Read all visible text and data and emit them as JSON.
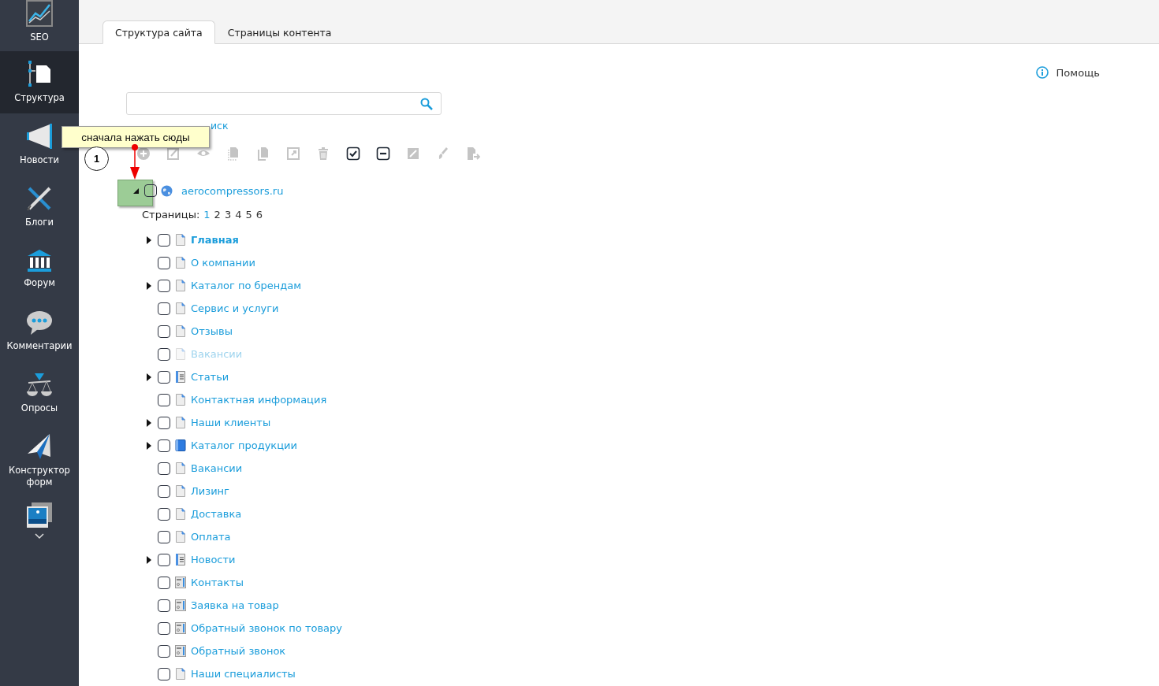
{
  "sidebar": {
    "items": [
      {
        "label": "SEO",
        "kind": "seo",
        "selected": false
      },
      {
        "label": "Структура",
        "kind": "structure",
        "selected": true
      },
      {
        "label": "Новости",
        "kind": "news",
        "selected": false
      },
      {
        "label": "Блоги",
        "kind": "blogs",
        "selected": false
      },
      {
        "label": "Форум",
        "kind": "forum",
        "selected": false
      },
      {
        "label": "Комментарии",
        "kind": "comments",
        "selected": false
      },
      {
        "label": "Опросы",
        "kind": "polls",
        "selected": false
      },
      {
        "label": "Конструктор форм",
        "kind": "forms",
        "selected": false
      },
      {
        "kind": "gallery",
        "selected": false
      }
    ]
  },
  "tabs": [
    {
      "label": "Структура сайта",
      "selected": true
    },
    {
      "label": "Страницы контента",
      "selected": false
    }
  ],
  "help": {
    "label": "Помощь"
  },
  "search_link": {
    "label": "иск"
  },
  "toolbar": [
    {
      "kind": "add",
      "disabled": true
    },
    {
      "kind": "edit",
      "disabled": true
    },
    {
      "kind": "view",
      "disabled": true
    },
    {
      "kind": "copy-dotted",
      "disabled": true
    },
    {
      "kind": "copy",
      "disabled": true
    },
    {
      "kind": "open",
      "disabled": true
    },
    {
      "kind": "delete",
      "disabled": true
    },
    {
      "kind": "check",
      "disabled": false
    },
    {
      "kind": "uncheck",
      "disabled": false
    },
    {
      "kind": "image",
      "disabled": true
    },
    {
      "kind": "brush",
      "disabled": true
    },
    {
      "kind": "export",
      "disabled": true
    }
  ],
  "annotation": {
    "callout": "сначала нажать сюды",
    "step": "1"
  },
  "tree": {
    "root": {
      "label": "aerocompressors.ru",
      "expanded": true,
      "checked": false
    },
    "pages_label": "Страницы:",
    "pages": [
      {
        "label": "1",
        "selected": true
      },
      {
        "label": "2",
        "selected": false
      },
      {
        "label": "3",
        "selected": false
      },
      {
        "label": "4",
        "selected": false
      },
      {
        "label": "5",
        "selected": false
      },
      {
        "label": "6",
        "selected": false
      }
    ],
    "children": [
      {
        "label": "Главная",
        "kind": "page",
        "expandable": true,
        "checked": false,
        "is_default": true,
        "inactive": false
      },
      {
        "label": "О компании",
        "kind": "page",
        "expandable": false,
        "checked": false,
        "is_default": false,
        "inactive": false
      },
      {
        "label": "Каталог по брендам",
        "kind": "page",
        "expandable": true,
        "checked": false,
        "is_default": false,
        "inactive": false
      },
      {
        "label": "Сервис и услуги",
        "kind": "page",
        "expandable": false,
        "checked": false,
        "is_default": false,
        "inactive": false
      },
      {
        "label": "Отзывы",
        "kind": "page",
        "expandable": false,
        "checked": false,
        "is_default": false,
        "inactive": false
      },
      {
        "label": "Вакансии",
        "kind": "page",
        "expandable": false,
        "checked": false,
        "is_default": false,
        "inactive": true
      },
      {
        "label": "Статьи",
        "kind": "list",
        "expandable": true,
        "checked": false,
        "is_default": false,
        "inactive": false
      },
      {
        "label": "Контактная информация",
        "kind": "page",
        "expandable": false,
        "checked": false,
        "is_default": false,
        "inactive": false
      },
      {
        "label": "Наши клиенты",
        "kind": "page",
        "expandable": true,
        "checked": false,
        "is_default": false,
        "inactive": false
      },
      {
        "label": "Каталог продукции",
        "kind": "catalog",
        "expandable": true,
        "checked": false,
        "is_default": false,
        "inactive": false
      },
      {
        "label": "Вакансии",
        "kind": "page",
        "expandable": false,
        "checked": false,
        "is_default": false,
        "inactive": false
      },
      {
        "label": "Лизинг",
        "kind": "page",
        "expandable": false,
        "checked": false,
        "is_default": false,
        "inactive": false
      },
      {
        "label": "Доставка",
        "kind": "page",
        "expandable": false,
        "checked": false,
        "is_default": false,
        "inactive": false
      },
      {
        "label": "Оплата",
        "kind": "page",
        "expandable": false,
        "checked": false,
        "is_default": false,
        "inactive": false
      },
      {
        "label": "Новости",
        "kind": "list",
        "expandable": true,
        "checked": false,
        "is_default": false,
        "inactive": false
      },
      {
        "label": "Контакты",
        "kind": "form",
        "expandable": false,
        "checked": false,
        "is_default": false,
        "inactive": false
      },
      {
        "label": "Заявка на товар",
        "kind": "form",
        "expandable": false,
        "checked": false,
        "is_default": false,
        "inactive": false
      },
      {
        "label": "Обратный звонок по товару",
        "kind": "form",
        "expandable": false,
        "checked": false,
        "is_default": false,
        "inactive": false
      },
      {
        "label": "Обратный звонок",
        "kind": "form",
        "expandable": false,
        "checked": false,
        "is_default": false,
        "inactive": false
      },
      {
        "label": "Наши специалисты",
        "kind": "page",
        "expandable": false,
        "checked": false,
        "is_default": false,
        "inactive": false
      }
    ]
  }
}
